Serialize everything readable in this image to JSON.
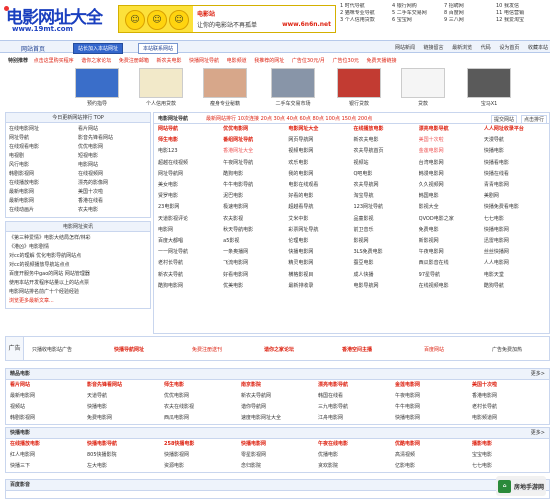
{
  "header": {
    "logo_title": "电影网址大全",
    "logo_url": "www.19mt.com",
    "banner": {
      "line1": "电影站",
      "line2": "让你的电影站不再孤单",
      "line3": "www.6n6n.net"
    },
    "top_links": [
      [
        "1 时代导航",
        "4 银行网购",
        "7 招聘网",
        "10 我发信"
      ],
      [
        "2 猫咪专业导航",
        "5 二手车交易网",
        "8 百度网",
        "11 电信营销"
      ],
      [
        "3 个人信用贷款",
        "6 宝宝网",
        "9 三八网",
        "12 我爱淘宝"
      ]
    ]
  },
  "nav": {
    "home": "网站首页",
    "add_button": "站长加入本站网址",
    "contact_button": "本站联系网站",
    "right_links": [
      "网站新闻",
      "链接留言",
      "最新浏览",
      "代码",
      "设为首页",
      "收藏本站"
    ]
  },
  "recommend": {
    "label": "特别推荐",
    "items": [
      "点击这里购买程序",
      "谐你之家论坛",
      "免费注册邮箱",
      "新农夫电影",
      "快播网址导航",
      "电影频道",
      "我推荐的网址",
      "广告位30元/月",
      "广告位30元",
      "免费天播链接"
    ]
  },
  "image_links": [
    {
      "label": "预约指导",
      "color": "#3a6ec9"
    },
    {
      "label": "个人信用贷款",
      "color": "#f2e9c9"
    },
    {
      "label": "瘦身专业秘籍",
      "color": "#d7a78a"
    },
    {
      "label": "二手车交易市场",
      "color": "#8895a8"
    },
    {
      "label": "银行贷款",
      "color": "#c23b32"
    },
    {
      "label": "贷款",
      "color": "#f5f5f5"
    },
    {
      "label": "宝马X1",
      "color": "#5a5a5a"
    }
  ],
  "tips": {
    "title": "今日更新网站排行 TOP",
    "items": [
      [
        "在线电影网址",
        "看片网站"
      ],
      [
        "网址导航",
        "影音先锋看网站"
      ],
      [
        "在线观看电影",
        "优优电影网"
      ],
      [
        "电视剧",
        "短视电影"
      ],
      [
        "风行电影",
        "电影网站"
      ],
      [
        "韩剧影视网",
        "在线视频网"
      ],
      [
        "在线播放电影",
        "漂亮的影像网"
      ],
      [
        "最新电影网",
        "美国十次啦"
      ],
      [
        "最新电影网",
        "香港在线看"
      ],
      [
        "在线动画片",
        "农夫电影"
      ]
    ]
  },
  "news": {
    "title": "电影网址资讯",
    "items": [
      "《第三种爱情》电影大结局怎样/林彩",
      "《港凶》电影剧情",
      "对cc的理解 优化电影导航网站点",
      "对cc的视频播放导航站点点",
      "百度开服务中gao的网站 网站管理器",
      "使用本站开发程序站量以上的站点票",
      "电影网站排名前广十个经验经验",
      "浏览更多最新文章..."
    ]
  },
  "main": {
    "tabs_label": "电影网址导航",
    "tags": [
      "最新网站排行",
      "10次连接",
      "20点",
      "30点",
      "40点",
      "60点",
      "80点",
      "100点",
      "150点",
      "200点"
    ],
    "action_tabs": [
      "提交网站",
      "点击排行"
    ],
    "grid": [
      [
        "网站导航",
        "优优电影网",
        "电影网址大全",
        "在线播放电影",
        "漂亮电影导航",
        "人人网址收录平台"
      ],
      [
        "师生电影",
        "番组网址导航",
        "网页导航网",
        "新农夫电影",
        "美国十次啦",
        "天漫导航"
      ],
      [
        "电影123",
        "香港网址大全",
        "视频电影网",
        "农夫导航首页",
        "金莲电影网",
        "快播电影"
      ],
      [
        "超越在线视频",
        "午夜网址导航",
        "欢乐电影",
        "视频站",
        "台湾电影网",
        "快播看电影"
      ],
      [
        "网址导航网",
        "酷狗电影",
        "我的电影网",
        "Q吧电影",
        "韩漫电影网",
        "快播在线看"
      ],
      [
        "美女电影",
        "牛牛电影导航",
        "电影在线观看",
        "农夫导航网",
        "久久视频网",
        "青青电影网"
      ],
      [
        "贤罗电影",
        "泥巴电影",
        "好看的电影",
        "淘宝导航",
        "韩国电影",
        "美剧网"
      ],
      [
        "23电影网",
        "极速电影网",
        "超越看导航",
        "123网址导航",
        "影视大全",
        "快播免费看电影"
      ],
      [
        "天道影视评论",
        "农夫影视",
        "艾米中影",
        "品童影视",
        "QVOD电影之家",
        "七七电影"
      ],
      [
        "电影网",
        "秋天导航电影",
        "彩票网址导航",
        "前卫音乐",
        "免费电影",
        "快播电影网"
      ],
      [
        "百度大都唱",
        "a5影视",
        "伦理电影",
        "影视网",
        "新影视网",
        "迅雷电影网"
      ],
      [
        "一一网址导航",
        "一条奥播网",
        "快播电影网",
        "3LS免费电影",
        "午夜电影网",
        "丝丝快播网"
      ],
      [
        "老村长导航",
        "飞流电影网",
        "精灵电影网",
        "蚕豆电影",
        "西瓜影音在线",
        "人人电影网"
      ],
      [
        "新农夫导航",
        "好看电影网",
        "横格影视目",
        "成人快播",
        "97星导航",
        "电影天堂"
      ],
      [
        "酷狗电影网",
        "优美电影",
        "最新排收录",
        "电影导航网",
        "在线视频电影",
        "酷狗导航"
      ]
    ]
  },
  "ad_bar": {
    "label": "广告",
    "items": [
      "只播收电影站广告",
      "快播导航网址",
      "免费注册送刊",
      "谐你之家论坛",
      "香港空间主播",
      "百度网站",
      "广告免费加热"
    ]
  },
  "sections": [
    {
      "title": "精品电影",
      "more": "更多>",
      "rows": [
        [
          "看片网站",
          "影音先锋看网站",
          "师生电影",
          "南京影院",
          "漂亮电影导航",
          "金莲电影网",
          "美国十次啦"
        ],
        [
          "最新电影网",
          "天道导航",
          "优优电影网",
          "新农夫导航网",
          "韩国在线看",
          "午夜电影网",
          "香港电影网"
        ],
        [
          "视频站",
          "快播电影",
          "农夫在线影视",
          "谐你导航网",
          "三九电影导航",
          "牛牛电影网",
          "老村长导航"
        ],
        [
          "韩剧影视网",
          "免费电影网",
          "西瓜电影网",
          "速度电影网址大全",
          "江舟电影网",
          "快播电影网",
          "电影频道网"
        ]
      ]
    },
    {
      "title": "快播电影",
      "more": "更多>",
      "rows": [
        [
          "在线播放电影",
          "快播电影导航",
          "258快播电影",
          "快播电影网",
          "午夜在线电影",
          "优酷电影网",
          "播影电影"
        ],
        [
          "红人电影网",
          "805快播影院",
          "快播影视网",
          "零星影视网",
          "优播电影",
          "高清视频",
          "宝宝电影"
        ],
        [
          "快播三下",
          "左大电影",
          "资源电影",
          "念归影院",
          "贪欢影院",
          "亿影电影",
          "七七电影"
        ]
      ]
    },
    {
      "title": "百度影音",
      "more": "",
      "rows": []
    }
  ],
  "watermark": "房地手游网"
}
